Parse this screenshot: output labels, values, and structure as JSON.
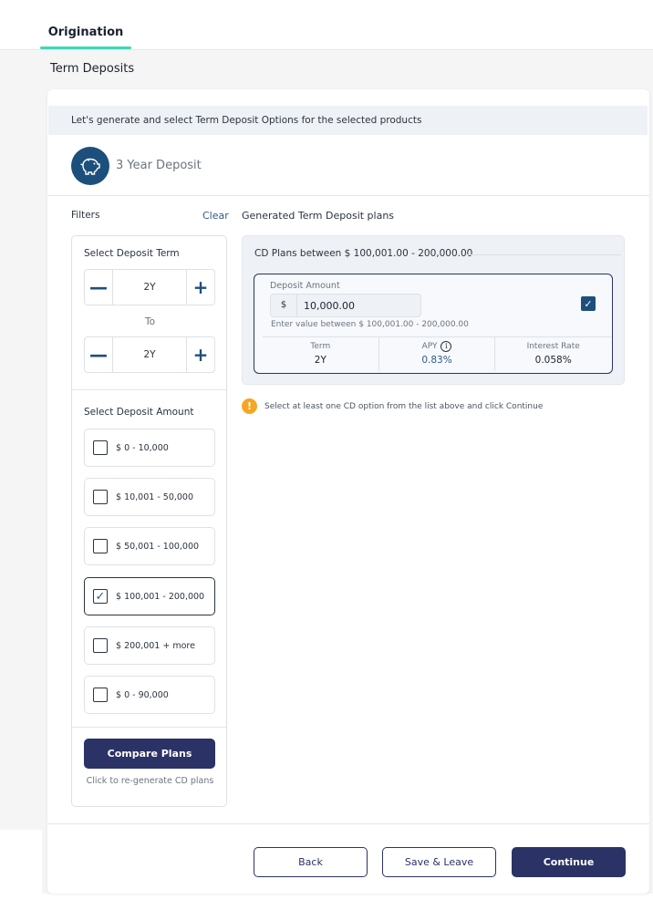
{
  "tabs": {
    "active_label": "Origination"
  },
  "page": {
    "title": "Term Deposits"
  },
  "banner": {
    "text": "Let's generate and select  Term Deposit Options for the selected products"
  },
  "product": {
    "name": "3 Year Deposit",
    "icon": "piggy-bank-icon"
  },
  "filters": {
    "label": "Filters",
    "clear_label": "Clear",
    "term": {
      "label": "Select Deposit Term",
      "from_value": "2Y",
      "to_label": "To",
      "to_value": "2Y",
      "minus_glyph": "—",
      "plus_glyph": "+"
    },
    "amount": {
      "label": "Select Deposit Amount",
      "options": [
        {
          "label": "$ 0 - 10,000",
          "checked": false
        },
        {
          "label": "$ 10,001 - 50,000",
          "checked": false
        },
        {
          "label": "$ 50,001 - 100,000",
          "checked": false
        },
        {
          "label": "$ 100,001 - 200,000",
          "checked": true
        },
        {
          "label": "$ 200,001 + more",
          "checked": false
        },
        {
          "label": "$ 0 - 90,000",
          "checked": false
        }
      ],
      "check_glyph": "✓"
    },
    "compare_button": "Compare Plans",
    "compare_hint": "Click to re-generate CD plans"
  },
  "plans": {
    "section_label": "Generated Term Deposit plans",
    "group_title": "CD Plans between $ 100,001.00 - 200,000.00",
    "card": {
      "amount_label": "Deposit Amount",
      "currency": "$",
      "amount_value": "10,000.00",
      "selected": true,
      "check_glyph": "✓",
      "hint": "Enter value between $ 100,001.00 - 200,000.00",
      "term_label": "Term",
      "term_value": "2Y",
      "apy_label": "APY",
      "apy_info_glyph": "i",
      "apy_value": "0.83%",
      "rate_label": "Interest Rate",
      "rate_value": "0.058%"
    }
  },
  "warning": {
    "glyph": "!",
    "text": "Select at least one CD option from the list above and click Continue"
  },
  "footer": {
    "back": "Back",
    "save_leave": "Save & Leave",
    "continue": "Continue"
  },
  "colors": {
    "accent_teal": "#3dd6b5",
    "primary_navy": "#2b3266",
    "brand_blue": "#1d4f7c",
    "warning": "#f5a623"
  }
}
